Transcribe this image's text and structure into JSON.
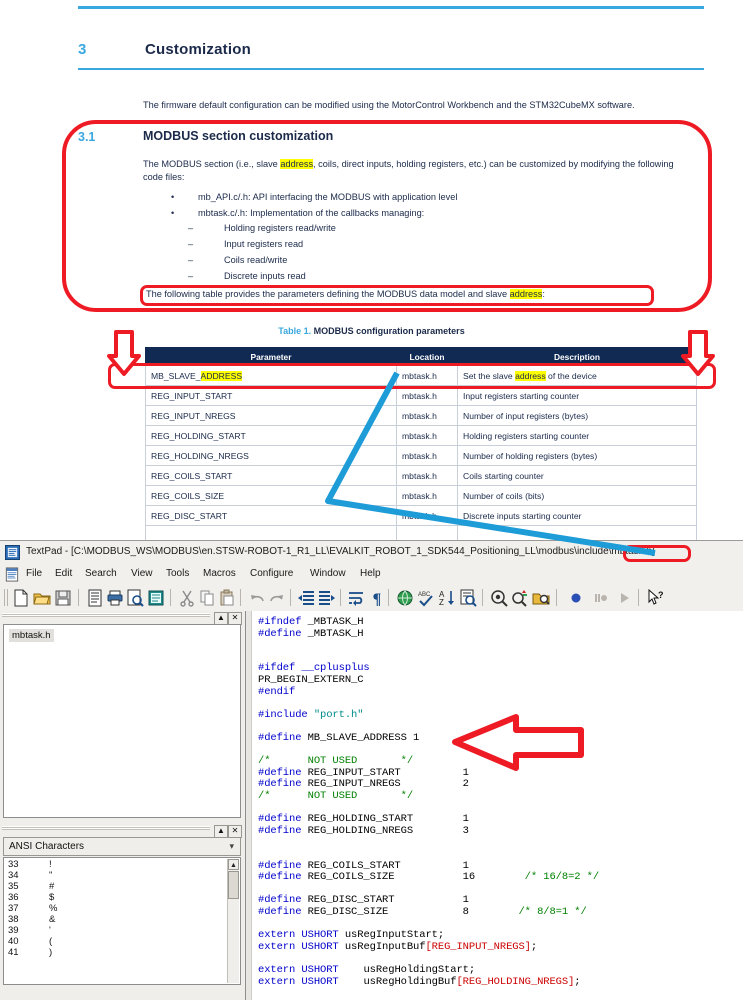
{
  "document": {
    "section_number": "3",
    "section_title": "Customization",
    "intro": "The firmware default configuration can be modified using the MotorControl Workbench and the STM32CubeMX software.",
    "sub_number": "3.1",
    "sub_title": "MODBUS section customization",
    "para1_a": "The MODBUS section (i.e., slave ",
    "para1_hl": "address",
    "para1_b": ", coils, direct inputs, holding registers, etc.) can be customized by modifying the following code files:",
    "bullets": [
      "mb_API.c/.h: API interfacing the MODBUS with application level",
      "mbtask.c/.h: Implementation of the callbacks managing:"
    ],
    "sub_bullets": [
      "Holding registers read/write",
      "Input registers read",
      "Coils read/write",
      "Discrete inputs read"
    ],
    "para2_a": "The following table provides the parameters defining the MODBUS data model and slave ",
    "para2_hl": "address",
    "para2_b": ":",
    "table_caption_num": "Table 1.",
    "table_caption_txt": "MODBUS configuration parameters",
    "table": {
      "headers": [
        "Parameter",
        "Location",
        "Description"
      ],
      "rows": [
        {
          "parameter_a": "MB_SLAVE_",
          "parameter_hl": "ADDRESS",
          "parameter_b": "",
          "location": "mbtask.h",
          "description_a": "Set the slave ",
          "description_hl": "address",
          "description_b": " of the device"
        },
        {
          "parameter_a": "REG_INPUT_START",
          "parameter_hl": "",
          "parameter_b": "",
          "location": "mbtask.h",
          "description_a": "Input registers starting counter",
          "description_hl": "",
          "description_b": ""
        },
        {
          "parameter_a": "REG_INPUT_NREGS",
          "parameter_hl": "",
          "parameter_b": "",
          "location": "mbtask.h",
          "description_a": "Number of input registers (bytes)",
          "description_hl": "",
          "description_b": ""
        },
        {
          "parameter_a": "REG_HOLDING_START",
          "parameter_hl": "",
          "parameter_b": "",
          "location": "mbtask.h",
          "description_a": "Holding registers starting counter",
          "description_hl": "",
          "description_b": ""
        },
        {
          "parameter_a": "REG_HOLDING_NREGS",
          "parameter_hl": "",
          "parameter_b": "",
          "location": "mbtask.h",
          "description_a": "Number of holding registers (bytes)",
          "description_hl": "",
          "description_b": ""
        },
        {
          "parameter_a": "REG_COILS_START",
          "parameter_hl": "",
          "parameter_b": "",
          "location": "mbtask.h",
          "description_a": "Coils starting counter",
          "description_hl": "",
          "description_b": ""
        },
        {
          "parameter_a": "REG_COILS_SIZE",
          "parameter_hl": "",
          "parameter_b": "",
          "location": "mbtask.h",
          "description_a": "Number of coils (bits)",
          "description_hl": "",
          "description_b": ""
        },
        {
          "parameter_a": "REG_DISC_START",
          "parameter_hl": "",
          "parameter_b": "",
          "location": "mbtask.h",
          "description_a": "Discrete inputs starting counter",
          "description_hl": "",
          "description_b": ""
        },
        {
          "parameter_a": "",
          "parameter_hl": "",
          "parameter_b": "",
          "location": "",
          "description_a": "",
          "description_hl": "",
          "description_b": ""
        }
      ]
    }
  },
  "textpad": {
    "title": "TextPad - [C:\\MODBUS_WS\\MODBUS\\en.STSW-ROBOT-1_R1_LL\\EVALKIT_ROBOT_1_SDK544_Positioning_LL\\modbus\\include\\mbtask.h]",
    "menu": [
      "File",
      "Edit",
      "Search",
      "View",
      "Tools",
      "Macros",
      "Configure",
      "Window",
      "Help"
    ],
    "document_selector": {
      "selected": "mbtask.h"
    },
    "clip_library": {
      "selected": "ANSI Characters",
      "rows": [
        {
          "code": "33",
          "glyph": "!"
        },
        {
          "code": "34",
          "glyph": "\""
        },
        {
          "code": "35",
          "glyph": "#"
        },
        {
          "code": "36",
          "glyph": "$"
        },
        {
          "code": "37",
          "glyph": "%"
        },
        {
          "code": "38",
          "glyph": "&"
        },
        {
          "code": "39",
          "glyph": "'"
        },
        {
          "code": "40",
          "glyph": "("
        },
        {
          "code": "41",
          "glyph": ")"
        }
      ]
    },
    "code_lines": [
      [
        {
          "t": "#ifndef ",
          "c": "kw"
        },
        {
          "t": "_MBTASK_H",
          "c": "id"
        }
      ],
      [
        {
          "t": "#define ",
          "c": "kw"
        },
        {
          "t": "_MBTASK_H",
          "c": "id"
        }
      ],
      [],
      [],
      [
        {
          "t": "#ifdef ",
          "c": "kw"
        },
        {
          "t": "__cplusplus",
          "c": "kw"
        }
      ],
      [
        {
          "t": "PR_BEGIN_EXTERN_C",
          "c": "id"
        }
      ],
      [
        {
          "t": "#endif",
          "c": "kw"
        }
      ],
      [],
      [
        {
          "t": "#include ",
          "c": "kw"
        },
        {
          "t": "\"port.h\"",
          "c": "str"
        }
      ],
      [],
      [
        {
          "t": "#define ",
          "c": "kw"
        },
        {
          "t": "MB_SLAVE_ADDRESS 1",
          "c": "id"
        }
      ],
      [],
      [
        {
          "t": "/*",
          "c": "cm"
        },
        {
          "t": "      NOT USED       ",
          "c": "cm"
        },
        {
          "t": "*/",
          "c": "cm"
        }
      ],
      [
        {
          "t": "#define ",
          "c": "kw"
        },
        {
          "t": "REG_INPUT_START",
          "c": "id"
        },
        {
          "t": "          1",
          "c": "id"
        }
      ],
      [
        {
          "t": "#define ",
          "c": "kw"
        },
        {
          "t": "REG_INPUT_NREGS",
          "c": "id"
        },
        {
          "t": "          2",
          "c": "id"
        }
      ],
      [
        {
          "t": "/*",
          "c": "cm"
        },
        {
          "t": "      NOT USED       ",
          "c": "cm"
        },
        {
          "t": "*/",
          "c": "cm"
        }
      ],
      [],
      [
        {
          "t": "#define ",
          "c": "kw"
        },
        {
          "t": "REG_HOLDING_START",
          "c": "id"
        },
        {
          "t": "        1",
          "c": "id"
        }
      ],
      [
        {
          "t": "#define ",
          "c": "kw"
        },
        {
          "t": "REG_HOLDING_NREGS",
          "c": "id"
        },
        {
          "t": "        3",
          "c": "id"
        }
      ],
      [],
      [],
      [
        {
          "t": "#define ",
          "c": "kw"
        },
        {
          "t": "REG_COILS_START",
          "c": "id"
        },
        {
          "t": "          1",
          "c": "id"
        }
      ],
      [
        {
          "t": "#define ",
          "c": "kw"
        },
        {
          "t": "REG_COILS_SIZE",
          "c": "id"
        },
        {
          "t": "           16        ",
          "c": "id"
        },
        {
          "t": "/* 16/8=2 */",
          "c": "cm"
        }
      ],
      [],
      [
        {
          "t": "#define ",
          "c": "kw"
        },
        {
          "t": "REG_DISC_START",
          "c": "id"
        },
        {
          "t": "           1",
          "c": "id"
        }
      ],
      [
        {
          "t": "#define ",
          "c": "kw"
        },
        {
          "t": "REG_DISC_SIZE",
          "c": "id"
        },
        {
          "t": "            8        ",
          "c": "id"
        },
        {
          "t": "/* 8/8=1 */",
          "c": "cm"
        }
      ],
      [],
      [
        {
          "t": "extern ",
          "c": "kw"
        },
        {
          "t": "USHORT ",
          "c": "kw"
        },
        {
          "t": "usRegInputStart;",
          "c": "id"
        }
      ],
      [
        {
          "t": "extern ",
          "c": "kw"
        },
        {
          "t": "USHORT ",
          "c": "kw"
        },
        {
          "t": "usRegInputBuf",
          "c": "id"
        },
        {
          "t": "[REG_INPUT_NREGS]",
          "c": "rd"
        },
        {
          "t": ";",
          "c": "id"
        }
      ],
      [],
      [
        {
          "t": "extern ",
          "c": "kw"
        },
        {
          "t": "USHORT ",
          "c": "kw"
        },
        {
          "t": "   usRegHoldingStart;",
          "c": "id"
        }
      ],
      [
        {
          "t": "extern ",
          "c": "kw"
        },
        {
          "t": "USHORT ",
          "c": "kw"
        },
        {
          "t": "   usRegHoldingBuf",
          "c": "id"
        },
        {
          "t": "[REG_HOLDING_NREGS]",
          "c": "rd"
        },
        {
          "t": ";",
          "c": "id"
        }
      ]
    ]
  },
  "annotations": {
    "accent_red": "#ee1b24",
    "accent_blue": "#1e9cd7",
    "highlight_yellow": "#ffff00",
    "header_navy": "#102a54",
    "doc_blue": "#3aa8e0"
  }
}
